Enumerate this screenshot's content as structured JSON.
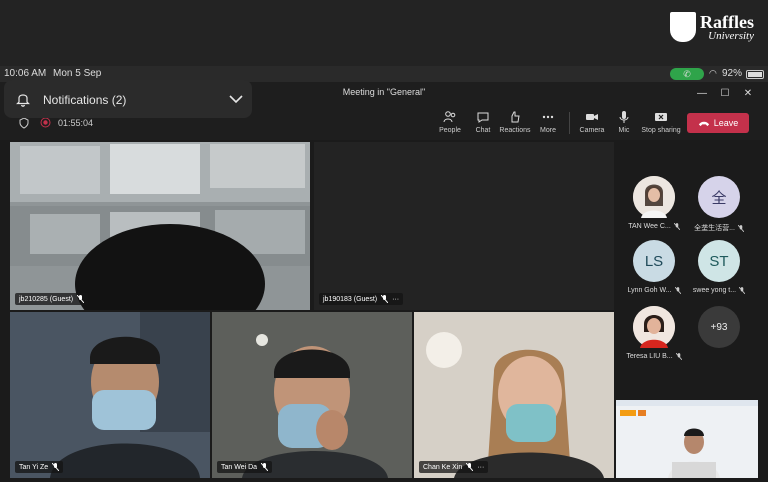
{
  "brand": {
    "name": "Raffles",
    "sub": "University"
  },
  "status": {
    "time": "10:06 AM",
    "date": "Mon 5 Sep",
    "battery": "92%"
  },
  "window": {
    "title": "Meeting in \"General\""
  },
  "notifications": {
    "label": "Notifications (2)"
  },
  "toolbar": {
    "timer": "01:55:04",
    "people": "People",
    "chat": "Chat",
    "reactions": "Reactions",
    "more": "More",
    "camera": "Camera",
    "mic": "Mic",
    "stop_sharing": "Stop sharing",
    "leave": "Leave"
  },
  "tiles": [
    {
      "name": "jb210285 (Guest)"
    },
    {
      "name": "jb190183 (Guest)"
    },
    {
      "name": "Tan Yi Ze"
    },
    {
      "name": "Tan Wei Da"
    },
    {
      "name": "Chan Ke Xin"
    }
  ],
  "participants": [
    {
      "name": "TAN Wee C...",
      "initials": ""
    },
    {
      "name": "全垄生活营...",
      "initials": "全"
    },
    {
      "name": "Lynn Goh W...",
      "initials": "LS"
    },
    {
      "name": "swee yong t...",
      "initials": "ST"
    },
    {
      "name": "Teresa LIU B...",
      "initials": ""
    },
    {
      "name": "",
      "initials": "+93"
    }
  ]
}
